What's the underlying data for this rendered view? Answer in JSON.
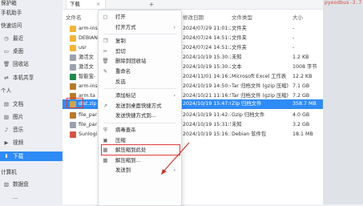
{
  "sidebar": {
    "items": [
      {
        "label": "保护箱",
        "icon": "",
        "kind": "head"
      },
      {
        "label": "手机助手",
        "icon": "",
        "kind": "head"
      },
      {
        "label": "快速访问",
        "icon": "",
        "kind": "head"
      },
      {
        "label": "最近",
        "icon": "clock-icon",
        "kind": "item"
      },
      {
        "label": "桌面",
        "icon": "desktop-icon",
        "kind": "item"
      },
      {
        "label": "回收站",
        "icon": "trash-icon",
        "kind": "item"
      },
      {
        "label": "本机共享",
        "icon": "share-icon",
        "kind": "item"
      },
      {
        "label": "个人",
        "icon": "",
        "kind": "head"
      },
      {
        "label": "文档",
        "icon": "document-icon",
        "kind": "item"
      },
      {
        "label": "图片",
        "icon": "picture-icon",
        "kind": "item"
      },
      {
        "label": "音乐",
        "icon": "music-icon",
        "kind": "item"
      },
      {
        "label": "视频",
        "icon": "video-icon",
        "kind": "item"
      },
      {
        "label": "下载",
        "icon": "download-icon",
        "kind": "item",
        "active": true
      },
      {
        "label": "计算机",
        "icon": "",
        "kind": "head"
      },
      {
        "label": "数据盘",
        "icon": "disk-icon",
        "kind": "item"
      },
      {
        "label": "...",
        "icon": "",
        "kind": "item"
      }
    ]
  },
  "toolbar": {
    "tab_label": "下载",
    "tab_close": "×",
    "new_tab": "+"
  },
  "columns": {
    "name": "文件名",
    "modified": "修改日期",
    "type": "文件类型",
    "size": "大小"
  },
  "files": [
    {
      "name": "arm-ins",
      "modified": "2024/07/29 11:01:28",
      "type": "文件夹",
      "size": "-",
      "icon": "folder-icon"
    },
    {
      "name": "DEBIAN",
      "modified": "2024/07/24 14:51:28",
      "type": "文件夹",
      "size": "-",
      "icon": "folder-icon"
    },
    {
      "name": "usr",
      "modified": "2024/07/24 14:51:28",
      "type": "文件夹",
      "size": "-",
      "icon": "folder-icon"
    },
    {
      "name": "激活文",
      "modified": "2024/10/19 15:30:20",
      "type": "未知",
      "size": "1.2 KB",
      "icon": "file-icon"
    },
    {
      "name": "激活文",
      "modified": "2024/10/19 15:30:20",
      "type": "文本",
      "size": "1008 字节",
      "icon": "file-icon"
    },
    {
      "name": "智能宝-",
      "modified": "2024/11/01 14:16:26",
      "type": "Microsoft Excel 工作表",
      "size": "12.2 KB",
      "icon": "excel-icon"
    },
    {
      "name": "arm-ins",
      "modified": "2024/10/19 14:50:49",
      "type": "Tar 归档文件 (gzip 压缩)",
      "size": "7.1 GB",
      "icon": "archive-icon"
    },
    {
      "name": "arm.ta",
      "modified": "2024/10/21 11:16:56",
      "type": "Tar 归档文件 (gzip 压缩)",
      "size": "7.2 GB",
      "icon": "archive-icon"
    },
    {
      "name": "dist.zip",
      "modified": "2024/10/19 15:47:03",
      "type": "Zip 归档文件",
      "size": "358.7 MB",
      "icon": "zip-icon",
      "selected": true
    },
    {
      "name": "file_par",
      "modified": "2024/10/19 11:42:36",
      "type": "Gzip 归档文件",
      "size": "4.0 GB",
      "icon": "archive-icon"
    },
    {
      "name": "file_par",
      "modified": "2024/10/19 15:31:50",
      "type": "未知",
      "size": "3.2 GB",
      "icon": "file-icon"
    },
    {
      "name": "Sunlogi",
      "modified": "2024/10/19 15:16:12",
      "type": "Debian 软件包",
      "size": "18.1 MB",
      "icon": "deb-icon"
    }
  ],
  "context_menu": {
    "items": [
      {
        "label": "打开",
        "icon": "open-icon",
        "submenu": false
      },
      {
        "label": "打开方式",
        "icon": "",
        "submenu": true
      },
      {
        "sep": true
      },
      {
        "label": "复制",
        "icon": "copy-icon",
        "submenu": false
      },
      {
        "label": "剪切",
        "icon": "cut-icon",
        "submenu": false
      },
      {
        "label": "删除到回收站",
        "icon": "trash-icon",
        "submenu": false
      },
      {
        "label": "重命名",
        "icon": "rename-icon",
        "submenu": false
      },
      {
        "label": "反选",
        "icon": "",
        "submenu": false
      },
      {
        "sep": true
      },
      {
        "label": "添加标记",
        "icon": "",
        "submenu": true
      },
      {
        "label": "发送到桌面快捷方式",
        "icon": "desktop-shortcut-icon",
        "submenu": false
      },
      {
        "label": "发送快捷方式到...",
        "icon": "",
        "submenu": false
      },
      {
        "sep": true
      },
      {
        "label": "病毒查杀",
        "icon": "shield-icon",
        "submenu": false
      },
      {
        "label": "压缩",
        "icon": "compress-icon",
        "submenu": false
      },
      {
        "label": "解压缩到此处",
        "icon": "extract-here-icon",
        "submenu": false,
        "highlight": true
      },
      {
        "label": "解压缩到...",
        "icon": "extract-icon",
        "submenu": false
      },
      {
        "label": "发送到",
        "icon": "",
        "submenu": true
      }
    ]
  },
  "code_snippet": "pyeodbus-3.7.",
  "window_controls": {
    "minimize": "–",
    "maximize": "□",
    "close": "×"
  },
  "colors": {
    "accent": "#2f8bf5",
    "highlight_border": "#e23b3b",
    "arrow": "#c0392b"
  }
}
